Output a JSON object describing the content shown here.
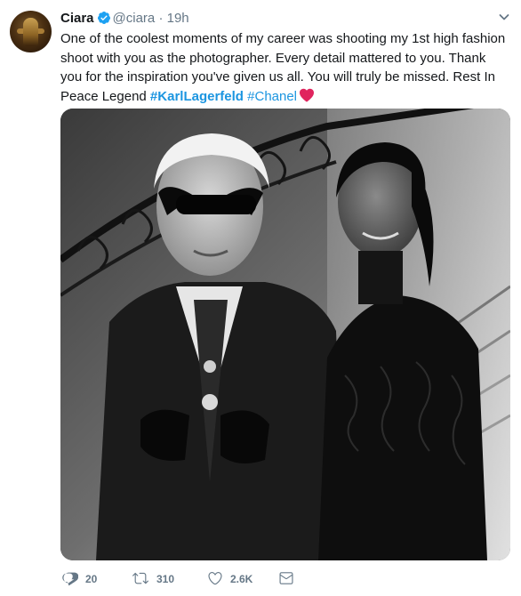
{
  "tweet": {
    "author_name": "Ciara",
    "handle": "@ciara",
    "separator": "·",
    "time": "19h",
    "text_main": "One of the coolest moments of my career was shooting my 1st high fashion shoot with you as the photographer. Every detail mattered to you. Thank you for the inspiration you've given us all. You will truly be missed. Rest In Peace Legend ",
    "hashtag_1": "#KarlLagerfeld",
    "hashtag_2": "#Chanel",
    "heart_icon": "red-heart-emoji"
  },
  "actions": {
    "replies": "20",
    "retweets": "310",
    "likes": "2.6K"
  },
  "colors": {
    "link": "#1b95e0",
    "muted": "#657786",
    "verified": "#1da1f2",
    "heart": "#e0245e"
  },
  "icons": {
    "verified": "verified-badge-icon",
    "menu": "chevron-down-icon",
    "reply": "reply-icon",
    "retweet": "retweet-icon",
    "like": "heart-icon",
    "dm": "envelope-icon"
  }
}
